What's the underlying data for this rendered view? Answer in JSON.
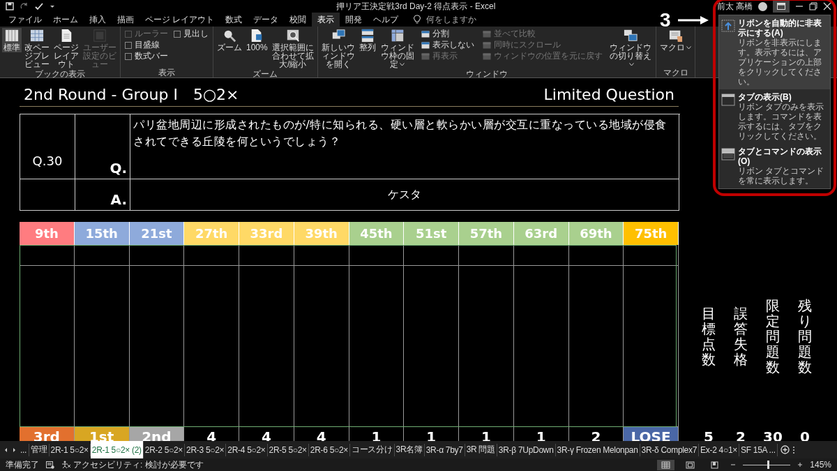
{
  "window": {
    "title": "押リア王決定戦3rd Day-2 得点表示 - Excel",
    "user": "前太 高橋"
  },
  "annotation": {
    "label": "3"
  },
  "tabs": [
    {
      "label": "ファイル",
      "selected": false
    },
    {
      "label": "ホーム",
      "selected": false
    },
    {
      "label": "挿入",
      "selected": false
    },
    {
      "label": "描画",
      "selected": false
    },
    {
      "label": "ページ レイアウト",
      "selected": false
    },
    {
      "label": "数式",
      "selected": false
    },
    {
      "label": "データ",
      "selected": false
    },
    {
      "label": "校閲",
      "selected": false
    },
    {
      "label": "表示",
      "selected": true
    },
    {
      "label": "開発",
      "selected": false
    },
    {
      "label": "ヘルプ",
      "selected": false
    }
  ],
  "tell_me": {
    "placeholder": "何をしますか"
  },
  "ribbon": {
    "groups": [
      {
        "label": "ブックの表示",
        "items": [
          {
            "kind": "large",
            "label": "標準",
            "selected": true,
            "disabled": false
          },
          {
            "kind": "large",
            "label": "改ページプレビュー",
            "selected": false,
            "disabled": false
          },
          {
            "kind": "large",
            "label": "ページレイアウト",
            "selected": false,
            "disabled": false
          },
          {
            "kind": "large",
            "label": "ユーザー設定のビュー",
            "selected": false,
            "disabled": true
          }
        ]
      },
      {
        "label": "表示",
        "items": [
          {
            "kind": "stack",
            "items": [
              {
                "kind": "check",
                "label": "ルーラー",
                "checked": false,
                "disabled": true
              },
              {
                "kind": "check",
                "label": "目盛線",
                "checked": false,
                "disabled": false
              },
              {
                "kind": "check",
                "label": "数式バー",
                "checked": false,
                "disabled": false
              }
            ]
          },
          {
            "kind": "stack",
            "items": [
              {
                "kind": "check",
                "label": "見出し",
                "checked": false,
                "disabled": false
              }
            ]
          }
        ]
      },
      {
        "label": "ズーム",
        "items": [
          {
            "kind": "large",
            "label": "ズーム",
            "disabled": false
          },
          {
            "kind": "large",
            "label": "100%",
            "disabled": false
          },
          {
            "kind": "large",
            "label": "選択範囲に合わせて拡大/縮小",
            "disabled": false
          }
        ]
      },
      {
        "label": "ウィンドウ",
        "items": [
          {
            "kind": "large",
            "label": "新しいウィンドウを開く",
            "disabled": false
          },
          {
            "kind": "large",
            "label": "整列",
            "disabled": false
          },
          {
            "kind": "large",
            "label": "ウィンドウ枠の固定",
            "dropdown": true,
            "disabled": false
          },
          {
            "kind": "stack",
            "items": [
              {
                "kind": "small",
                "label": "分割",
                "disabled": false
              },
              {
                "kind": "small",
                "label": "表示しない",
                "disabled": false
              },
              {
                "kind": "small",
                "label": "再表示",
                "disabled": true
              }
            ]
          },
          {
            "kind": "stack",
            "items": [
              {
                "kind": "small",
                "label": "並べて比較",
                "disabled": true
              },
              {
                "kind": "small",
                "label": "同時にスクロール",
                "disabled": true
              },
              {
                "kind": "small",
                "label": "ウィンドウの位置を元に戻す",
                "disabled": true
              }
            ]
          },
          {
            "kind": "large",
            "label": "ウィンドウの切り替え",
            "dropdown": true,
            "disabled": false
          }
        ]
      },
      {
        "label": "マクロ",
        "items": [
          {
            "kind": "large",
            "label": "マクロ",
            "dropdown": true,
            "disabled": false
          }
        ]
      }
    ]
  },
  "ribbon_options": {
    "items": [
      {
        "title": "リボンを自動的に非表示にする(A)",
        "description": "リボンを非表示にします。表示するには、アプリケーションの上部をクリックしてください。",
        "selected": true
      },
      {
        "title": "タブの表示(B)",
        "description": "リボン タブのみを表示します。コマンドを表示するには、タブをクリックしてください。",
        "selected": false
      },
      {
        "title": "タブとコマンドの表示(O)",
        "description": "リボン タブとコマンドを常に表示します。",
        "selected": false
      }
    ]
  },
  "sheet": {
    "title": "2nd Round - Group I　5○2×",
    "subtitle": "Limited Question",
    "question": {
      "number": "Q.30",
      "q_label": "Q.",
      "text": "パリ盆地周辺に形成されたものが/特に知られる、硬い層と軟らかい層が交互に重なっている地域が侵食されてできる丘陵を何というでしょう？",
      "a_label": "A.",
      "answer": "ケスタ"
    },
    "ranks": [
      {
        "label": "9th",
        "color": "#ff7c80"
      },
      {
        "label": "15th",
        "color": "#8eaadb"
      },
      {
        "label": "21st",
        "color": "#8eaadb"
      },
      {
        "label": "27th",
        "color": "#ffd966"
      },
      {
        "label": "33rd",
        "color": "#ffd966"
      },
      {
        "label": "39th",
        "color": "#ffd966"
      },
      {
        "label": "45th",
        "color": "#a9d08e"
      },
      {
        "label": "51st",
        "color": "#a9d08e"
      },
      {
        "label": "57th",
        "color": "#a9d08e"
      },
      {
        "label": "63rd",
        "color": "#a9d08e"
      },
      {
        "label": "69th",
        "color": "#a9d08e"
      },
      {
        "label": "75th",
        "color": "#ffc000"
      }
    ],
    "results": [
      {
        "label": "3rd",
        "color": "#e2702e"
      },
      {
        "label": "1st",
        "color": "#d8a622"
      },
      {
        "label": "2nd",
        "color": "#a6a6a6"
      },
      {
        "label": "4"
      },
      {
        "label": "4"
      },
      {
        "label": "4"
      },
      {
        "label": "1"
      },
      {
        "label": "1"
      },
      {
        "label": "1"
      },
      {
        "label": "1"
      },
      {
        "label": "2"
      },
      {
        "label": "LOSE",
        "color": "#4a67a6"
      }
    ],
    "stats": [
      {
        "label": "目標点数",
        "value": "5"
      },
      {
        "label": "誤答失格",
        "value": "2"
      },
      {
        "label": "限定問題数",
        "value": "30"
      },
      {
        "label": "残り問題数",
        "value": "0"
      }
    ]
  },
  "sheet_nav": {
    "more": "..."
  },
  "sheet_tabs": [
    {
      "label": "管理",
      "selected": false
    },
    {
      "label": "2R-1 5○2×",
      "selected": false
    },
    {
      "label": "2R-1 5○2× (2)",
      "selected": true
    },
    {
      "label": "2R-2 5○2×",
      "selected": false
    },
    {
      "label": "2R-3 5○2×",
      "selected": false
    },
    {
      "label": "2R-4 5○2×",
      "selected": false
    },
    {
      "label": "2R-5 5○2×",
      "selected": false
    },
    {
      "label": "2R-6 5○2×",
      "selected": false
    },
    {
      "label": "コース分け",
      "selected": false
    },
    {
      "label": "3R名簿",
      "selected": false
    },
    {
      "label": "3R-α 7by7",
      "selected": false
    },
    {
      "label": "3R 問題",
      "selected": false
    },
    {
      "label": "3R-β 7UpDown",
      "selected": false
    },
    {
      "label": "3R-γ Frozen Melonpan",
      "selected": false
    },
    {
      "label": "3R-δ Complex7",
      "selected": false
    },
    {
      "label": "Ex-2 4○1×",
      "selected": false
    },
    {
      "label": "SF 15A ...",
      "selected": false
    }
  ],
  "status_bar": {
    "status": "準備完了",
    "accessibility": "アクセシビリティ: 検討が必要です",
    "views": [
      {
        "selected": true
      },
      {
        "selected": false
      },
      {
        "selected": false
      }
    ],
    "zoom": {
      "level": 0.52
    },
    "zoom_label": "145%"
  }
}
